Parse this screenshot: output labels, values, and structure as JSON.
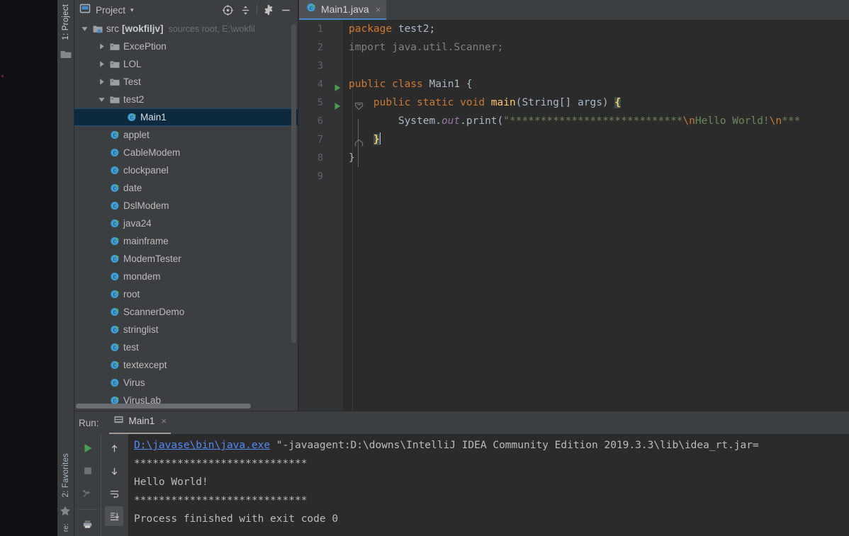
{
  "left_tool_bar": {
    "top_label": "1: Project",
    "top_icon": "folder-icon",
    "bottom_label": "2: Favorites",
    "bottom_icon": "star-icon",
    "bottom_extra_label": "re:"
  },
  "project_panel": {
    "title": "Project",
    "caret": "▾",
    "icons": [
      {
        "name": "project-view-icon",
        "glyph": "project"
      },
      {
        "name": "locate-icon",
        "glyph": "crosshair"
      },
      {
        "name": "collapse-all-icon",
        "glyph": "collapse"
      },
      {
        "name": "settings-gear-icon",
        "glyph": "gear"
      },
      {
        "name": "hide-icon",
        "glyph": "minus"
      }
    ],
    "tree": [
      {
        "label": "src",
        "bracket": "[wokfiljv]",
        "note": "sources root, E:\\wokfil",
        "icon": "source-folder-icon",
        "twisty": "expanded",
        "indent": 0,
        "selected": false
      },
      {
        "label": "ExcePtion",
        "icon": "folder-icon",
        "twisty": "collapsed",
        "indent": 1,
        "selected": false
      },
      {
        "label": "LOL",
        "icon": "folder-icon",
        "twisty": "collapsed",
        "indent": 1,
        "selected": false
      },
      {
        "label": "Test",
        "icon": "folder-icon",
        "twisty": "collapsed",
        "indent": 1,
        "selected": false
      },
      {
        "label": "test2",
        "icon": "folder-icon",
        "twisty": "expanded",
        "indent": 1,
        "selected": false
      },
      {
        "label": "Main1",
        "icon": "java-runnable-class-icon",
        "twisty": "none",
        "indent": 2,
        "selected": true
      },
      {
        "label": "applet",
        "icon": "java-runnable-class-icon",
        "twisty": "none",
        "indent": 1,
        "selected": false
      },
      {
        "label": "CableModem",
        "icon": "java-class-icon",
        "twisty": "none",
        "indent": 1,
        "selected": false
      },
      {
        "label": "clockpanel",
        "icon": "java-class-icon",
        "twisty": "none",
        "indent": 1,
        "selected": false
      },
      {
        "label": "date",
        "icon": "java-runnable-class-icon",
        "twisty": "none",
        "indent": 1,
        "selected": false
      },
      {
        "label": "DslModem",
        "icon": "java-class-icon",
        "twisty": "none",
        "indent": 1,
        "selected": false
      },
      {
        "label": "java24",
        "icon": "java-runnable-class-icon",
        "twisty": "none",
        "indent": 1,
        "selected": false
      },
      {
        "label": "mainframe",
        "icon": "java-runnable-class-icon",
        "twisty": "none",
        "indent": 1,
        "selected": false
      },
      {
        "label": "ModemTester",
        "icon": "java-runnable-class-icon",
        "twisty": "none",
        "indent": 1,
        "selected": false
      },
      {
        "label": "mondem",
        "icon": "java-class-icon",
        "twisty": "none",
        "indent": 1,
        "selected": false
      },
      {
        "label": "root",
        "icon": "java-runnable-class-icon",
        "twisty": "none",
        "indent": 1,
        "selected": false
      },
      {
        "label": "ScannerDemo",
        "icon": "java-runnable-class-icon",
        "twisty": "none",
        "indent": 1,
        "selected": false
      },
      {
        "label": "stringlist",
        "icon": "java-runnable-class-icon",
        "twisty": "none",
        "indent": 1,
        "selected": false
      },
      {
        "label": "test",
        "icon": "java-runnable-class-icon",
        "twisty": "none",
        "indent": 1,
        "selected": false
      },
      {
        "label": "textexcept",
        "icon": "java-runnable-class-icon",
        "twisty": "none",
        "indent": 1,
        "selected": false
      },
      {
        "label": "Virus",
        "icon": "java-class-icon",
        "twisty": "none",
        "indent": 1,
        "selected": false
      },
      {
        "label": "VirusLab",
        "icon": "java-runnable-class-icon",
        "twisty": "none",
        "indent": 1,
        "selected": false
      }
    ]
  },
  "editor": {
    "tab": {
      "title": "Main1.java",
      "icon": "java-runnable-class-icon",
      "close": "×"
    },
    "lines": [
      {
        "num": "1",
        "run": false,
        "fold": "",
        "tokens": [
          {
            "t": "package ",
            "c": "kw"
          },
          {
            "t": "test2;",
            "c": "plain"
          }
        ]
      },
      {
        "num": "2",
        "run": false,
        "fold": "",
        "tokens": [
          {
            "t": "import java.util.Scanner;",
            "c": "dim"
          }
        ]
      },
      {
        "num": "3",
        "run": false,
        "fold": "",
        "tokens": []
      },
      {
        "num": "4",
        "run": true,
        "fold": "",
        "tokens": [
          {
            "t": "public class ",
            "c": "kw"
          },
          {
            "t": "Main1 ",
            "c": "plain"
          },
          {
            "t": "{",
            "c": "plain"
          }
        ]
      },
      {
        "num": "5",
        "run": true,
        "fold": "minus",
        "tokens": [
          {
            "t": "    ",
            "c": "plain"
          },
          {
            "t": "public static void ",
            "c": "kw"
          },
          {
            "t": "main",
            "c": "fnc"
          },
          {
            "t": "(String[] args) ",
            "c": "plain"
          },
          {
            "t": "{",
            "c": "brace-hl"
          }
        ]
      },
      {
        "num": "6",
        "run": false,
        "fold": "",
        "tokens": [
          {
            "t": "        System.",
            "c": "plain"
          },
          {
            "t": "out",
            "c": "fld"
          },
          {
            "t": ".print(",
            "c": "plain"
          },
          {
            "t": "\"****************************",
            "c": "str"
          },
          {
            "t": "\\n",
            "c": "esc"
          },
          {
            "t": "Hello World!",
            "c": "str"
          },
          {
            "t": "\\n",
            "c": "esc"
          },
          {
            "t": "***",
            "c": "str"
          }
        ]
      },
      {
        "num": "7",
        "run": false,
        "fold": "brace",
        "tokens": [
          {
            "t": "    ",
            "c": "plain"
          },
          {
            "t": "}",
            "c": "brace-hl"
          },
          {
            "t": "CARET",
            "c": "caret"
          }
        ]
      },
      {
        "num": "8",
        "run": false,
        "fold": "",
        "tokens": [
          {
            "t": "}",
            "c": "plain"
          }
        ]
      },
      {
        "num": "9",
        "run": false,
        "fold": "",
        "tokens": []
      }
    ]
  },
  "run_panel": {
    "label": "Run:",
    "tab": {
      "title": "Main1",
      "icon": "run-config-icon",
      "close": "×"
    },
    "tools_left": [
      {
        "name": "rerun-button",
        "glyph": "play",
        "pressed": false
      },
      {
        "name": "stop-button",
        "glyph": "stop",
        "pressed": false
      },
      {
        "name": "dump-threads-button",
        "glyph": "threads",
        "pressed": false
      },
      {
        "name": "print-button",
        "glyph": "print",
        "pressed": false
      }
    ],
    "tools_right": [
      {
        "name": "scroll-up-button",
        "glyph": "arrow-up",
        "pressed": false
      },
      {
        "name": "scroll-down-button",
        "glyph": "arrow-down",
        "pressed": false
      },
      {
        "name": "soft-wrap-button",
        "glyph": "wrap",
        "pressed": false
      },
      {
        "name": "scroll-to-end-button",
        "glyph": "scroll-end",
        "pressed": true
      }
    ],
    "console": [
      {
        "link": "D:\\javase\\bin\\java.exe",
        "rest": " \"-javaagent:D:\\downs\\IntelliJ IDEA Community Edition 2019.3.3\\lib\\idea_rt.jar="
      },
      {
        "text": "****************************"
      },
      {
        "text": "Hello World!"
      },
      {
        "text": "****************************"
      },
      {
        "text": "Process finished with exit code 0"
      }
    ]
  },
  "colors": {
    "panel_bg": "#3c3f41",
    "editor_bg": "#2b2b2b",
    "gutter_bg": "#313335",
    "selection_bg": "#0d293e",
    "accent_blue": "#4a88c7",
    "link_blue": "#548af7",
    "keyword_orange": "#cc7832",
    "string_green": "#6a8759",
    "method_yellow": "#ffc66d",
    "field_purple": "#9876aa",
    "text_grey": "#a9b7c6",
    "run_green": "#499c54"
  }
}
